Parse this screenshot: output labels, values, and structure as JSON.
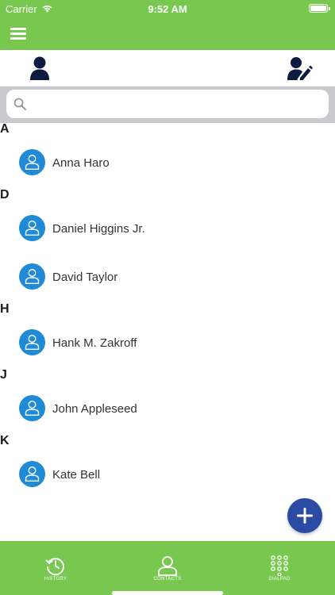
{
  "status_bar": {
    "carrier": "Carrier",
    "time": "9:52 AM"
  },
  "header": {
    "menu_icon": "hamburger-menu-icon"
  },
  "tabs": {
    "contacts_icon": "person-icon",
    "edit_icon": "person-edit-icon"
  },
  "search": {
    "placeholder": "",
    "value": ""
  },
  "sections": [
    {
      "letter": "A",
      "contacts": [
        "Anna Haro"
      ]
    },
    {
      "letter": "D",
      "contacts": [
        "Daniel Higgins Jr.",
        "David Taylor"
      ]
    },
    {
      "letter": "H",
      "contacts": [
        "Hank M. Zakroff"
      ]
    },
    {
      "letter": "J",
      "contacts": [
        "John Appleseed"
      ]
    },
    {
      "letter": "K",
      "contacts": [
        "Kate Bell"
      ]
    }
  ],
  "fab": {
    "icon": "plus-icon"
  },
  "bottom_nav": {
    "history_label": "HISTORY",
    "contacts_label": "CONTACTS",
    "dialpad_label": "DIALPAD"
  },
  "colors": {
    "brand_green": "#78c850",
    "avatar_blue": "#1f8ad6",
    "fab_blue": "#2b4aa3",
    "nav_icon_dark": "#0d1b3e"
  }
}
